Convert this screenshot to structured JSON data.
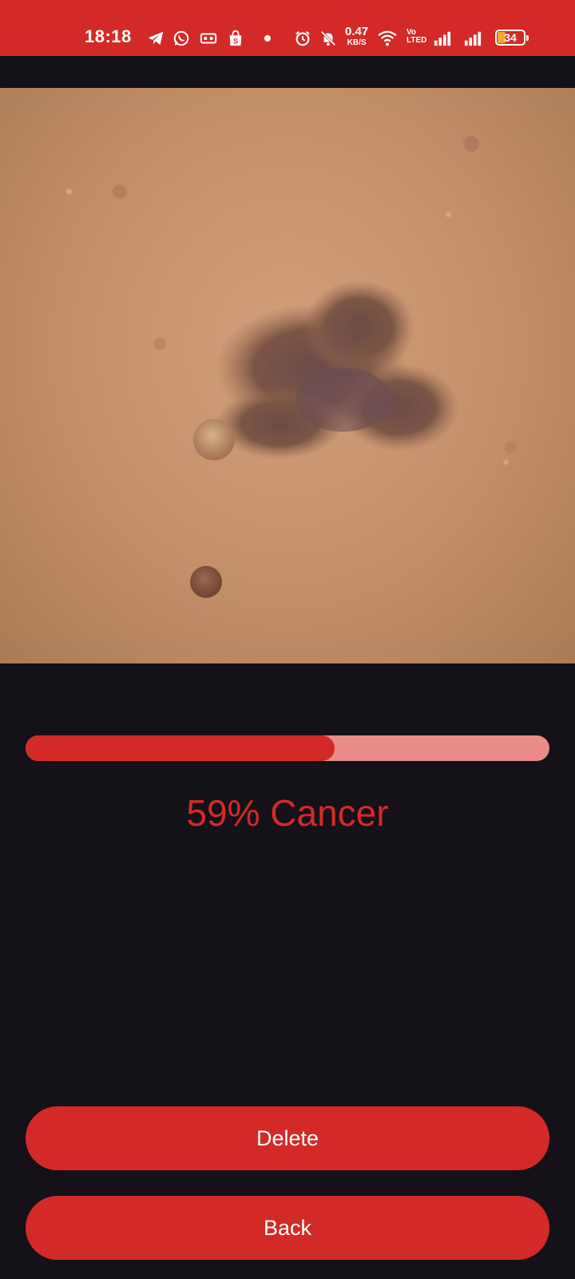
{
  "status_bar": {
    "time": "18:18",
    "net_speed_value": "0.47",
    "net_speed_unit": "KB/S",
    "volte_top": "Vo",
    "volte_bottom": "LTED",
    "battery_percent": "34",
    "icons": [
      "telegram-icon",
      "whatsapp-icon",
      "card-icon",
      "shopee-icon",
      "dot-icon",
      "alarm-icon",
      "mute-icon",
      "wifi-icon",
      "signal-icon",
      "signal-icon",
      "battery-icon"
    ]
  },
  "image": {
    "semantic": "skin-lesion-photo"
  },
  "result": {
    "progress_fraction": 0.59,
    "label": "59% Cancer"
  },
  "buttons": {
    "delete_label": "Delete",
    "back_label": "Back"
  },
  "colors": {
    "accent": "#d32a27",
    "track": "#eb8c89",
    "background": "#141118"
  }
}
